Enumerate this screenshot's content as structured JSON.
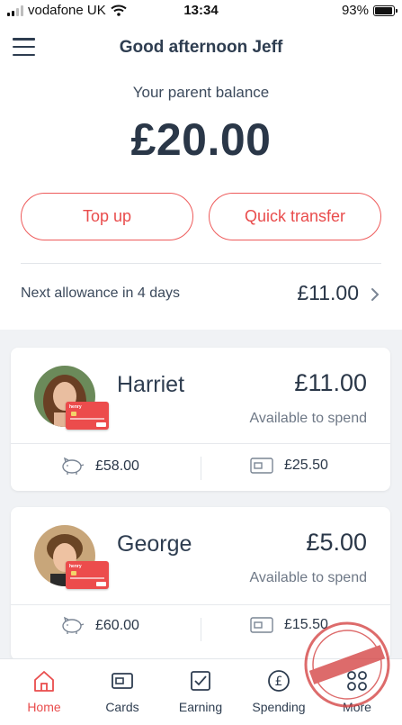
{
  "status_bar": {
    "carrier": "vodafone UK",
    "time": "13:34",
    "battery": "93%"
  },
  "header": {
    "greeting": "Good afternoon Jeff"
  },
  "balance": {
    "label": "Your parent balance",
    "amount": "£20.00"
  },
  "actions": {
    "top_up": "Top up",
    "quick_transfer": "Quick transfer"
  },
  "allowance": {
    "label": "Next allowance in 4 days",
    "amount": "£11.00"
  },
  "children": [
    {
      "name": "Harriet",
      "balance": "£11.00",
      "balance_label": "Available to spend",
      "savings": "£58.00",
      "card_balance": "£25.50"
    },
    {
      "name": "George",
      "balance": "£5.00",
      "balance_label": "Available to spend",
      "savings": "£60.00",
      "card_balance": "£15.50"
    }
  ],
  "tabs": [
    {
      "label": "Home",
      "icon": "home-icon",
      "active": true
    },
    {
      "label": "Cards",
      "icon": "card-icon"
    },
    {
      "label": "Earning",
      "icon": "checkbox-icon"
    },
    {
      "label": "Spending",
      "icon": "pound-coin-icon"
    },
    {
      "label": "More",
      "icon": "grid-icon"
    }
  ],
  "card_brand": "henry",
  "watermark": "PROTECTED IMAGE",
  "colors": {
    "accent": "#e94c4c",
    "text": "#2e3d50",
    "list_bg": "#f0f2f5"
  }
}
